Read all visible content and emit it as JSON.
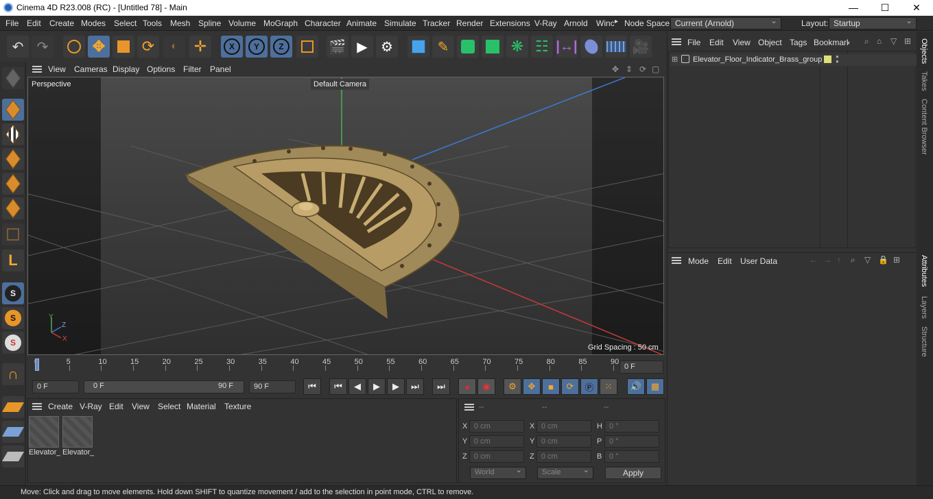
{
  "window": {
    "title": "Cinema 4D R23.008 (RC) - [Untitled 78] - Main",
    "minimize": "—",
    "maximize": "☐",
    "close": "✕"
  },
  "menubar": {
    "items": [
      "File",
      "Edit",
      "Create",
      "Modes",
      "Select",
      "Tools",
      "Mesh",
      "Spline",
      "Volume",
      "MoGraph",
      "Character",
      "Animate",
      "Simulate",
      "Tracker",
      "Render",
      "Extensions",
      "V-Ray",
      "Arnold",
      "Winc"
    ],
    "arrow": "▸",
    "node_space_label": "Node Space:",
    "node_space_value": "Current (Arnold)",
    "layout_label": "Layout:",
    "layout_value": "Startup"
  },
  "viewport": {
    "menu": [
      "View",
      "Cameras",
      "Display",
      "Options",
      "Filter",
      "Panel"
    ],
    "label": "Perspective",
    "camera": "Default Camera",
    "grid_spacing": "Grid Spacing : 50 cm",
    "axis_y": "Y",
    "axis_z": "Z",
    "axis_x": "X"
  },
  "timeline": {
    "ticks": [
      "0",
      "5",
      "10",
      "15",
      "20",
      "25",
      "30",
      "35",
      "40",
      "45",
      "50",
      "55",
      "60",
      "65",
      "70",
      "75",
      "80",
      "85",
      "90"
    ],
    "current_frame": "0 F"
  },
  "transport": {
    "start": "0 F",
    "range_start": "0 F",
    "range_end": "90 F",
    "end": "90 F"
  },
  "materials": {
    "menu": [
      "Create",
      "V-Ray",
      "Edit",
      "View",
      "Select",
      "Material",
      "Texture"
    ],
    "items": [
      "Elevator_",
      "Elevator_"
    ]
  },
  "coords": {
    "headers": [
      "--",
      "--",
      "--"
    ],
    "rows": [
      {
        "a": "X",
        "av": "0 cm",
        "b": "X",
        "bv": "0 cm",
        "c": "H",
        "cv": "0 °"
      },
      {
        "a": "Y",
        "av": "0 cm",
        "b": "Y",
        "bv": "0 cm",
        "c": "P",
        "cv": "0 °"
      },
      {
        "a": "Z",
        "av": "0 cm",
        "b": "Z",
        "bv": "0 cm",
        "c": "B",
        "cv": "0 °"
      }
    ],
    "mode": "World",
    "scale": "Scale",
    "apply": "Apply"
  },
  "objects": {
    "menu": [
      "File",
      "Edit",
      "View",
      "Object",
      "Tags",
      "Bookmarks"
    ],
    "items": [
      {
        "name": "Elevator_Floor_Indicator_Brass_group"
      }
    ]
  },
  "attributes": {
    "menu": [
      "Mode",
      "Edit",
      "User Data"
    ]
  },
  "sidetabs": [
    "Objects",
    "Takes",
    "Content Browser",
    "Attributes",
    "Layers",
    "Structure"
  ],
  "status": "Move: Click and drag to move elements. Hold down SHIFT to quantize movement / add to the selection in point mode, CTRL to remove."
}
